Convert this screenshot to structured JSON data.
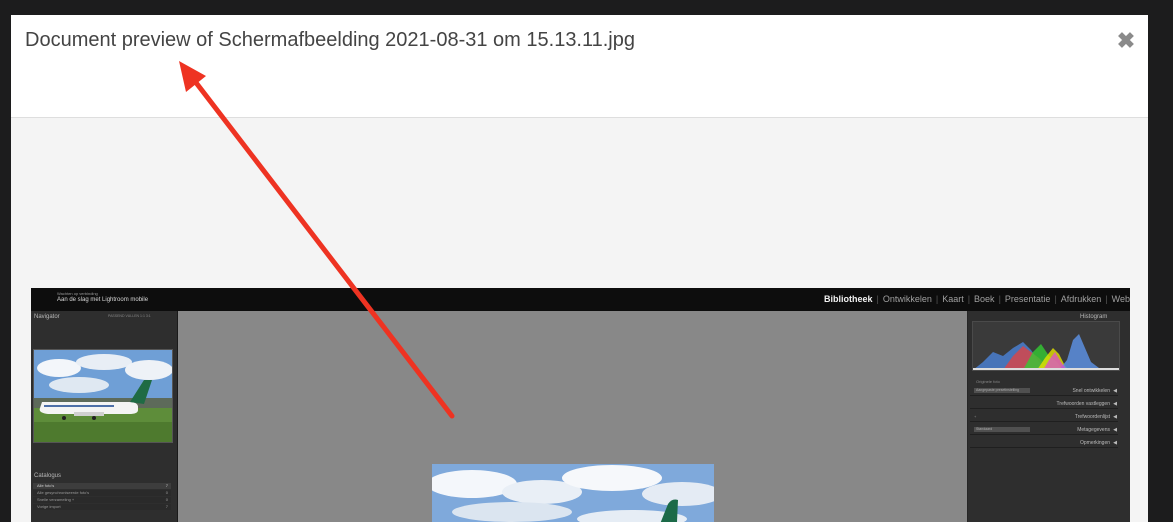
{
  "modal": {
    "title": "Document preview of Schermafbeelding 2021-08-31 om 15.13.11.jpg",
    "close_icon": "close-icon"
  },
  "annotation": {
    "arrow_color": "#ee3322"
  },
  "preview": {
    "identity_small": "Wachten op verbinding",
    "identity_plate": "Aan de slag met Lightroom mobile",
    "modules": [
      "Bibliotheek",
      "Ontwikkelen",
      "Kaart",
      "Boek",
      "Presentatie",
      "Afdrukken",
      "Web"
    ],
    "active_module": "Bibliotheek",
    "navigator": {
      "title": "Navigator",
      "options": "PASSEND  VULLEN  1:1  3:1"
    },
    "catalog": {
      "title": "Catalogus",
      "items": [
        {
          "label": "Alle foto's",
          "count": "7"
        },
        {
          "label": "Alle gesynchroniseerde foto's",
          "count": "0"
        },
        {
          "label": "Snelle verzameling +",
          "count": "0"
        },
        {
          "label": "Vorige import",
          "count": "7"
        }
      ]
    },
    "right_panel": {
      "histogram_title": "Histogram",
      "original_photo_label": "Originele foto",
      "rows": [
        {
          "dropdown": "Aangepaste presetinstelling",
          "label": "Snel ontwikkelen"
        },
        {
          "dropdown": "",
          "label": "Trefwoorden vastleggen"
        },
        {
          "dropdown": "",
          "label": "Trefwoordenlijst"
        },
        {
          "dropdown": "Standaard",
          "label": "Metagegevens"
        },
        {
          "dropdown": "",
          "label": "Opmerkingen"
        }
      ]
    }
  }
}
